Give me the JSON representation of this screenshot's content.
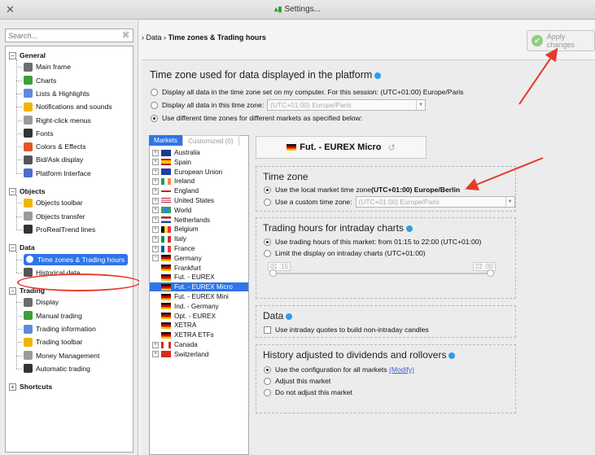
{
  "window": {
    "title": "Settings...",
    "close_glyph": "✕"
  },
  "search": {
    "placeholder": "Search...",
    "clear_glyph": "⌘"
  },
  "sidebar": {
    "groups": [
      {
        "label": "General",
        "items": [
          "Main frame",
          "Charts",
          "Lists & Highlights",
          "Notifications and sounds",
          "Right-click menus",
          "Fonts",
          "Colors & Effects",
          "Bid/Ask display",
          "Platform Interface"
        ]
      },
      {
        "label": "Objects",
        "items": [
          "Objects toolbar",
          "Objects transfer",
          "ProRealTrend lines"
        ]
      },
      {
        "label": "Data",
        "items": [
          "Time zones & Trading hours",
          "Historical data"
        ]
      },
      {
        "label": "Trading",
        "items": [
          "Display",
          "Manual trading",
          "Trading information",
          "Trading toolbar",
          "Money Management",
          "Automatic trading"
        ]
      },
      {
        "label": "Shortcuts",
        "items": []
      }
    ],
    "selected": "Time zones & Trading hours"
  },
  "breadcrumb": {
    "parent": "Data",
    "current": "Time zones & Trading hours",
    "sep": "›"
  },
  "apply_button": {
    "label": "Apply changes"
  },
  "main": {
    "heading": "Time zone used for data displayed in the platform",
    "options": [
      "Display all data in the time zone set on my computer. For this session: (UTC+01:00) Europe/Paris",
      "Display all data in this time zone:",
      "Use different time zones for different markets as specified below:"
    ],
    "tz_select": "(UTC+01:00) Europe/Paris"
  },
  "markets_panel": {
    "tab_markets": "Markets",
    "tab_customized": "Customized (0)",
    "rows": [
      {
        "label": "Australia",
        "expandable": true
      },
      {
        "label": "Spain",
        "expandable": true
      },
      {
        "label": "European Union",
        "expandable": true
      },
      {
        "label": "Ireland",
        "expandable": true
      },
      {
        "label": "England",
        "expandable": true
      },
      {
        "label": "United States",
        "expandable": true
      },
      {
        "label": "World",
        "expandable": true
      },
      {
        "label": "Netherlands",
        "expandable": true
      },
      {
        "label": "Belgium",
        "expandable": true
      },
      {
        "label": "Italy",
        "expandable": true
      },
      {
        "label": "France",
        "expandable": true
      },
      {
        "label": "Germany",
        "expandable": true,
        "expanded": true
      },
      {
        "label": "Frankfurt",
        "child": true
      },
      {
        "label": "Fut. - EUREX",
        "child": true
      },
      {
        "label": "Fut. - EUREX Micro",
        "child": true,
        "selected": true
      },
      {
        "label": "Fut. - EUREX Mini",
        "child": true
      },
      {
        "label": "Ind. - Germany",
        "child": true
      },
      {
        "label": "Opt. - EUREX",
        "child": true
      },
      {
        "label": "XETRA",
        "child": true
      },
      {
        "label": "XETRA ETFs",
        "child": true
      },
      {
        "label": "Canada",
        "expandable": true
      },
      {
        "label": "Switzerland",
        "expandable": true
      }
    ]
  },
  "market_detail": {
    "title": "Fut. - EUREX Micro",
    "timezone": {
      "title": "Time zone",
      "opt_local_prefix": "Use the local market time zone ",
      "opt_local_bold": "(UTC+01:00) Europe/Berlin",
      "opt_custom": "Use a custom time zone:",
      "custom_select": "(UTC+01:00) Europe/Paris"
    },
    "trading_hours": {
      "title": "Trading hours for intraday charts",
      "opt_market": "Use trading hours of this market: from 01:15 to 22:00 (UTC+01:00)",
      "opt_limit": "Limit the display on intraday charts  (UTC+01:00)",
      "start": "01 :15",
      "end": "22 :00"
    },
    "data": {
      "title": "Data",
      "opt_intraday": "Use intraday quotes to build non-intraday candles"
    },
    "history": {
      "title": "History adjusted to dividends and rollovers",
      "opt_config": "Use the configuration for all markets",
      "modify_link": "(Modify)",
      "opt_adjust": "Adjust this market",
      "opt_no_adjust": "Do not adjust this market"
    }
  }
}
